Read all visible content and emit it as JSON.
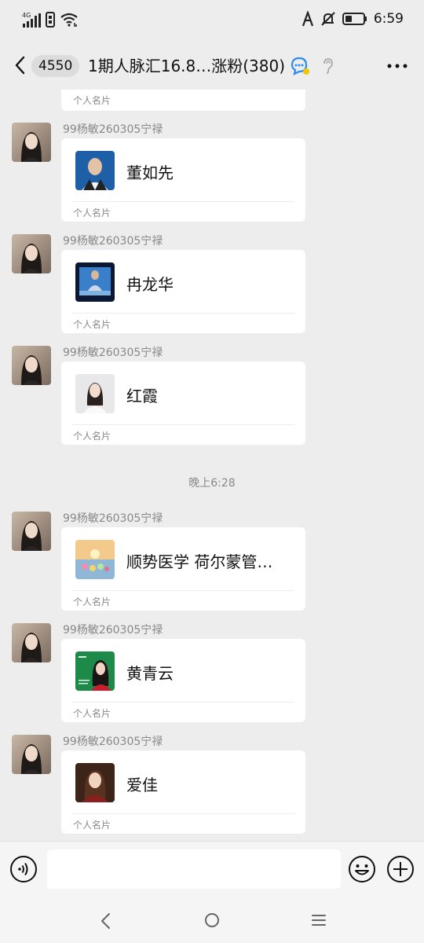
{
  "status_bar": {
    "network": "4G",
    "time": "6:59",
    "icons": [
      "signal-icon",
      "sim-icon",
      "wifi-icon",
      "autobrightness-icon",
      "mute-bell-icon",
      "battery-icon"
    ]
  },
  "header": {
    "unread_count": "4550",
    "title": "1期人脉汇16.8…涨粉(380)",
    "icons": [
      "back-icon",
      "chat-bubble-icon",
      "ear-icon",
      "more-icon"
    ]
  },
  "messages": {
    "partial_card_type": "个人名片",
    "items": [
      {
        "sender": "99杨敏260305宁禄",
        "card_name": "董如先",
        "card_type": "个人名片"
      },
      {
        "sender": "99杨敏260305宁禄",
        "card_name": "冉龙华",
        "card_type": "个人名片"
      },
      {
        "sender": "99杨敏260305宁禄",
        "card_name": "红霞",
        "card_type": "个人名片"
      },
      {
        "sender": "99杨敏260305宁禄",
        "card_name": "顺势医学  荷尔蒙管…",
        "card_type": "个人名片"
      },
      {
        "sender": "99杨敏260305宁禄",
        "card_name": "黄青云",
        "card_type": "个人名片"
      },
      {
        "sender": "99杨敏260305宁禄",
        "card_name": "爱佳",
        "card_type": "个人名片"
      }
    ],
    "time_separator": "晚上6:28"
  },
  "input_bar": {
    "text_value": "",
    "icons": [
      "voice-icon",
      "emoji-icon",
      "plus-icon"
    ]
  },
  "nav_bar": {
    "icons": [
      "nav-back-icon",
      "nav-home-icon",
      "nav-menu-icon"
    ]
  },
  "colors": {
    "background": "#ededed",
    "card": "#ffffff",
    "muted_text": "#888888"
  }
}
